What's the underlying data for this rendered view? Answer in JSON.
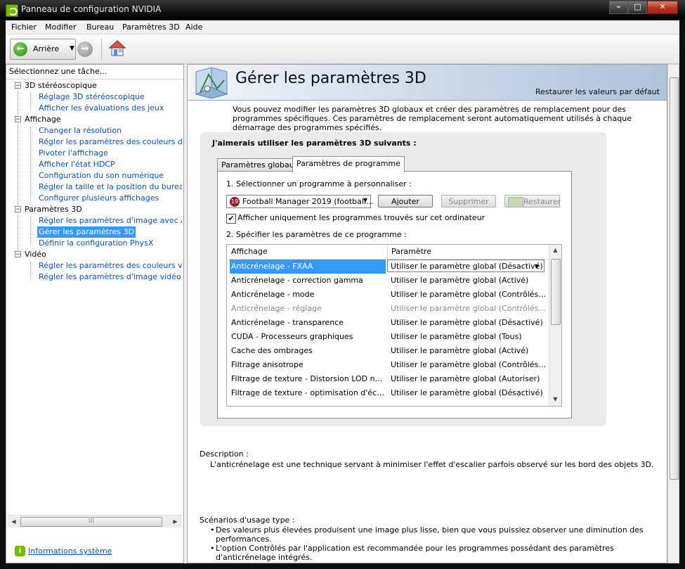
{
  "window": {
    "title": "Panneau de configuration NVIDIA",
    "minimize": "–",
    "maximize": "□",
    "close": "✕"
  },
  "menu": [
    "Fichier",
    "Modifier",
    "Bureau",
    "Paramètres 3D",
    "Aide"
  ],
  "toolbar": {
    "back_label": "Arrière",
    "back_icon": "back-arrow-icon",
    "forward_icon": "forward-arrow-icon",
    "home_icon": "home-icon"
  },
  "sidebar": {
    "header": "Sélectionnez une tâche...",
    "categories": [
      {
        "label": "3D stéréoscopique",
        "items": [
          "Réglage 3D stéréoscopique",
          "Afficher les évaluations des jeux"
        ]
      },
      {
        "label": "Affichage",
        "items": [
          "Changer la résolution",
          "Régler les paramètres des couleurs du bure",
          "Pivoter l'affichage",
          "Afficher l'état HDCP",
          "Configuration du son numérique",
          "Régler la taille et la position du bureau",
          "Configurer plusieurs affichages"
        ]
      },
      {
        "label": "Paramètres 3D",
        "items": [
          "Régler les paramètres d'image avec Aperçu",
          "Gérer les paramètres 3D",
          "Définir la configuration PhysX"
        ]
      },
      {
        "label": "Vidéo",
        "items": [
          "Régler les paramètres des couleurs vidéo",
          "Régler les paramètres d'image vidéo"
        ]
      }
    ],
    "selected_item": "Gérer les paramètres 3D",
    "system_info": "Informations système"
  },
  "main": {
    "title": "Gérer les paramètres 3D",
    "restore_defaults": "Restaurer les valeurs par défaut",
    "intro": "Vous pouvez modifier les paramètres 3D globaux et créer des paramètres de remplacement pour des programmes spécifiques. Ces paramètres de remplacement seront automatiquement utilisés à chaque démarrage des programmes spécifiés.",
    "heading": "J'aimerais utiliser les paramètres 3D suivants :",
    "tabs": [
      "Paramètres globaux",
      "Paramètres de programme"
    ],
    "active_tab": 1,
    "step1": "1. Sélectionner un programme à personnaliser :",
    "program": "Football Manager 2019 (football...",
    "program_badge": "19",
    "add_button": "Ajouter",
    "remove_button": "Supprimer",
    "restore_button": "Restaurer",
    "checkbox_label": "Afficher uniquement les programmes trouvés sur cet ordinateur",
    "checkbox_checked": true,
    "checkmark": "✔",
    "step2": "2. Spécifier les paramètres de ce programme :",
    "table": {
      "columns": [
        "Affichage",
        "Paramètre"
      ],
      "rows": [
        {
          "feature": "Anticrénelage - FXAA",
          "setting": "Utiliser le paramètre global (Désactivé)",
          "state": "selected"
        },
        {
          "feature": "Anticrénelage - correction gamma",
          "setting": "Utiliser le paramètre global (Activé)",
          "state": "normal"
        },
        {
          "feature": "Anticrénelage - mode",
          "setting": "Utiliser le paramètre global (Contrôlés par l...",
          "state": "normal"
        },
        {
          "feature": "Anticrénelage - réglage",
          "setting": "Utiliser le paramètre global (Contrôlés par l...",
          "state": "disabled"
        },
        {
          "feature": "Anticrénelage - transparence",
          "setting": "Utiliser le paramètre global (Désactivé)",
          "state": "normal"
        },
        {
          "feature": "CUDA - Processeurs graphiques",
          "setting": "Utiliser le paramètre global (Tous)",
          "state": "normal"
        },
        {
          "feature": "Cache des ombrages",
          "setting": "Utiliser le paramètre global (Activé)",
          "state": "normal"
        },
        {
          "feature": "Filtrage anisotrope",
          "setting": "Utiliser le paramètre global (Contrôlés par l...",
          "state": "normal"
        },
        {
          "feature": "Filtrage de texture - Distorsion LOD négative",
          "setting": "Utiliser le paramètre global (Autoriser)",
          "state": "normal"
        },
        {
          "feature": "Filtrage de texture - optimisation d'échanti...",
          "setting": "Utiliser le paramètre global (Désactivé)",
          "state": "normal"
        }
      ]
    },
    "description_title": "Description :",
    "description": "L'anticrénelage est une technique servant à minimiser l'effet d'escalier parfois observé sur les bord des objets 3D.",
    "scenarios_title": "Scénarios d'usage type :",
    "scenarios": [
      "Des valeurs plus élevées produisent une image plus lisse, bien que vous puissiez observer une diminution des performances.",
      "L'option Contrôlés par l'application est recommandée pour les programmes possédant des paramètres d'anticrénelage intégrés."
    ]
  },
  "colors": {
    "link": "#0a50b4",
    "selection": "#3399ff",
    "nvidia_green": "#76b900",
    "banner": "#c7d5e6"
  }
}
